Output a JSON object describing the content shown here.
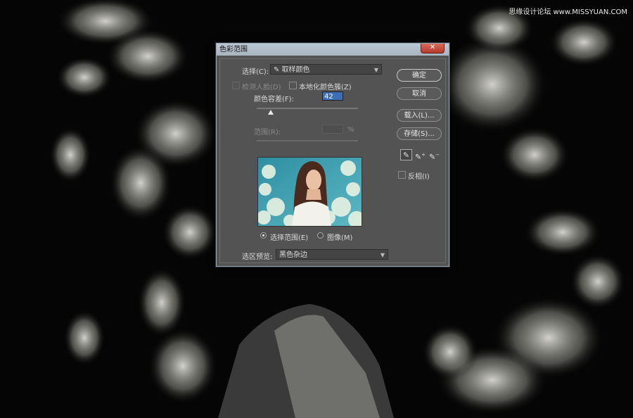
{
  "watermark": "思缘设计论坛 www.MISSYUAN.COM",
  "dialog": {
    "title": "色彩范围",
    "close_glyph": "✕",
    "select_label": "选择(C):",
    "select_value": "取样颜色",
    "detect_faces_label": "检测人脸(D)",
    "localized_clusters_label": "本地化颜色簇(Z)",
    "fuzziness_label": "颜色容差(F):",
    "fuzziness_value": "42",
    "fuzziness_fraction": 0.14,
    "range_label": "范围(R):",
    "range_value": "",
    "range_unit": "%",
    "radio_selection": "选择范围(E)",
    "radio_image": "图像(M)",
    "preview_label": "选区预览:",
    "preview_value": "黑色杂边",
    "buttons": {
      "ok": "确定",
      "cancel": "取消",
      "load": "载入(L)...",
      "save": "存储(S)..."
    },
    "invert_label": "反相(I)",
    "tools": [
      "eyedropper-icon",
      "eyedropper-plus-icon",
      "eyedropper-minus-icon"
    ],
    "colors": {
      "accent": "#3d6fb8",
      "panel": "#535353",
      "titlebar": "#b0bdc9"
    }
  }
}
